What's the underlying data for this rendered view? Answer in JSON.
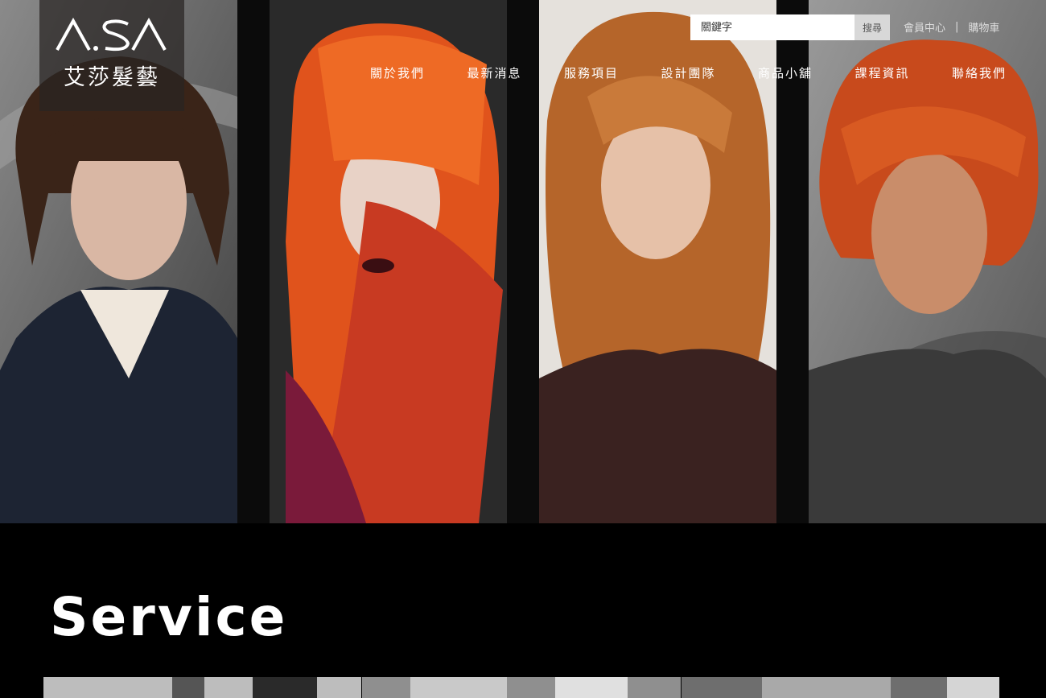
{
  "logo": {
    "brand": "A.SA",
    "name_cn": "艾莎髮藝"
  },
  "search": {
    "placeholder": "關鍵字",
    "button_label": "搜尋"
  },
  "top_links": {
    "member": "會員中心",
    "separator": "|",
    "cart": "購物車"
  },
  "nav": [
    {
      "label": "關於我們"
    },
    {
      "label": "最新消息"
    },
    {
      "label": "服務項目"
    },
    {
      "label": "設計團隊"
    },
    {
      "label": "商品小舖"
    },
    {
      "label": "課程資訊"
    },
    {
      "label": "聯絡我們"
    }
  ],
  "hero": {
    "panels": [
      {
        "name": "brunette-bob-model",
        "hair": "#3a2418",
        "skin": "#d9b7a4",
        "cloth": "#1d2433"
      },
      {
        "name": "orange-fringe-model",
        "hair": "#e0531c",
        "skin": "#e8d2c6",
        "cloth": "#7a1a3a"
      },
      {
        "name": "wavy-auburn-model",
        "hair": "#b5652a",
        "skin": "#e6c1a8",
        "cloth": "#3a2220"
      },
      {
        "name": "red-volume-model",
        "hair": "#c84a1c",
        "skin": "#c98d6a",
        "cloth": "#3a3a3a"
      }
    ]
  },
  "section": {
    "title": "Service"
  }
}
